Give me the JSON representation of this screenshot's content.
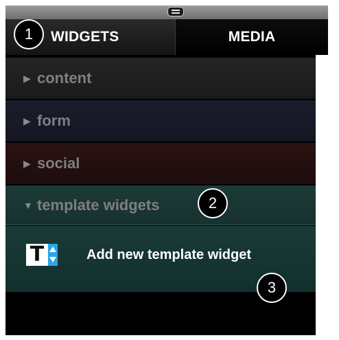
{
  "tabs": {
    "widgets": "WIDGETS",
    "media": "MEDIA"
  },
  "categories": [
    {
      "label": "content",
      "arrow": "▶",
      "expanded": false
    },
    {
      "label": "form",
      "arrow": "▶",
      "expanded": false
    },
    {
      "label": "social",
      "arrow": "▶",
      "expanded": false
    },
    {
      "label": "template widgets",
      "arrow": "▼",
      "expanded": true
    }
  ],
  "template_widgets": {
    "add_label": "Add new template widget",
    "icon": "T"
  },
  "callouts": [
    "1",
    "2",
    "3"
  ],
  "colors": {
    "content_bg": "#1f1f1f",
    "form_bg": "#181a28",
    "social_bg": "#251010",
    "template_bg": "#1c3836",
    "icon_accent": "#2aa6e6"
  }
}
